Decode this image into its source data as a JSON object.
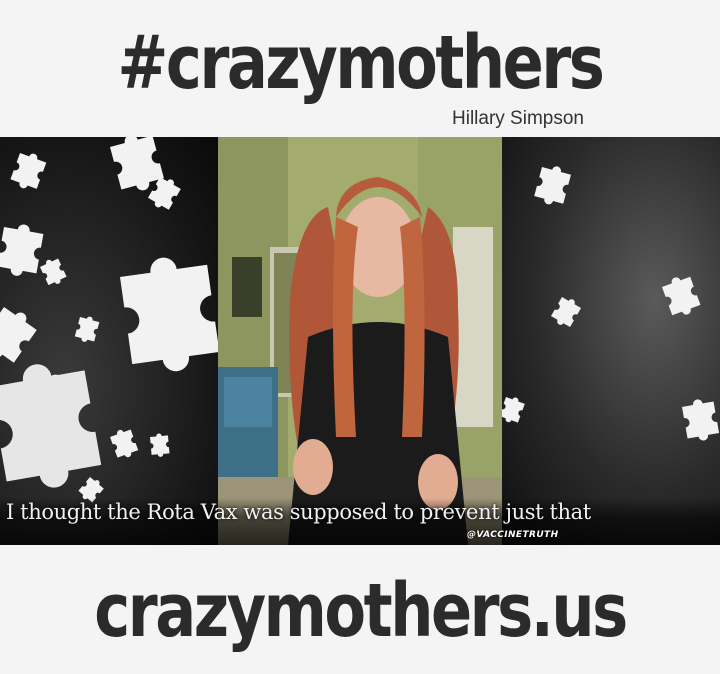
{
  "header": {
    "title": "#crazymothers",
    "byline": "Hillary Simpson"
  },
  "video": {
    "caption": "I thought the Rota Vax was supposed to prevent just that",
    "watermark": "@VACCINETRUTH",
    "decoration": "jigsaw-puzzle-pieces"
  },
  "footer": {
    "url": "crazymothers.us"
  },
  "colors": {
    "text": "#2b2b2b",
    "background": "#f4f4f4",
    "panel_dark": "#161616",
    "puzzle_piece": "#f2f2f2"
  }
}
